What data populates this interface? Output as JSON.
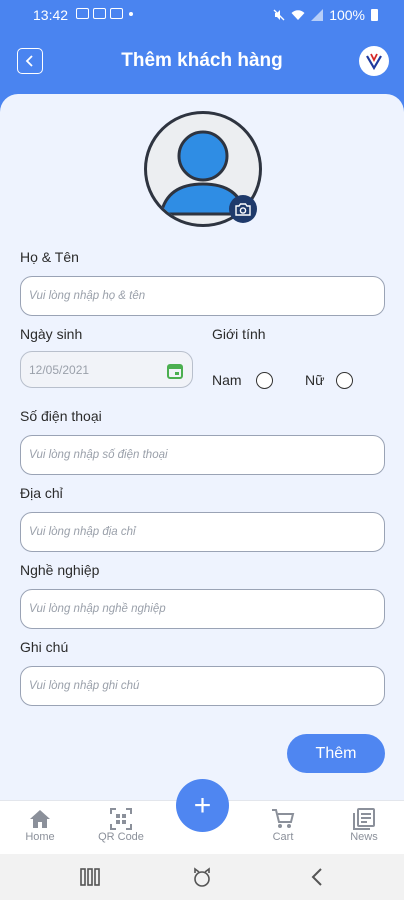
{
  "status_bar": {
    "time": "13:42",
    "battery": "100%"
  },
  "header": {
    "title": "Thêm khách hàng"
  },
  "form": {
    "full_name": {
      "label": "Họ & Tên",
      "placeholder": "Vui lòng nhập họ & tên"
    },
    "birthday": {
      "label": "Ngày sinh",
      "value": "12/05/2021"
    },
    "gender": {
      "label": "Giới tính",
      "options": [
        "Nam",
        "Nữ"
      ]
    },
    "phone": {
      "label": "Số điện thoại",
      "placeholder": "Vui lòng nhập số điện thoại"
    },
    "address": {
      "label": "Địa chỉ",
      "placeholder": "Vui lòng nhập địa chỉ"
    },
    "job": {
      "label": "Nghề nghiệp",
      "placeholder": "Vui lòng nhập nghề nghiệp"
    },
    "note": {
      "label": "Ghi chú",
      "placeholder": "Vui lòng nhập ghi chú"
    },
    "submit_label": "Thêm"
  },
  "bottom_nav": {
    "items": [
      {
        "label": "Home",
        "icon": "home-icon"
      },
      {
        "label": "QR Code",
        "icon": "qr-code-icon"
      },
      {
        "label": "Cart",
        "icon": "cart-icon"
      },
      {
        "label": "News",
        "icon": "news-icon"
      }
    ],
    "fab_symbol": "+"
  },
  "colors": {
    "primary": "#4a84f0",
    "background": "#eef3fe",
    "avatar_blue": "#2f8de4",
    "date_icon": "#4caf50"
  }
}
